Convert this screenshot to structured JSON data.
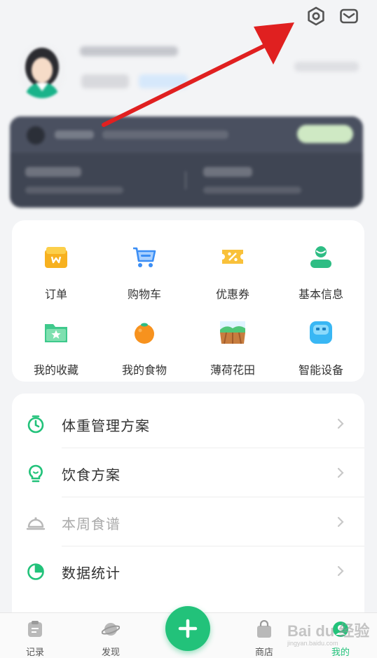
{
  "header": {
    "settings_icon": "gear-icon",
    "messages_icon": "mail-icon"
  },
  "quick_menu": [
    {
      "label": "订单",
      "icon": "order-box-icon"
    },
    {
      "label": "购物车",
      "icon": "shopping-cart-icon"
    },
    {
      "label": "优惠券",
      "icon": "coupon-icon"
    },
    {
      "label": "基本信息",
      "icon": "user-info-icon"
    },
    {
      "label": "我的收藏",
      "icon": "favorites-folder-icon"
    },
    {
      "label": "我的食物",
      "icon": "orange-fruit-icon"
    },
    {
      "label": "薄荷花田",
      "icon": "farm-field-icon"
    },
    {
      "label": "智能设备",
      "icon": "smart-device-icon"
    }
  ],
  "list_items": [
    {
      "label": "体重管理方案",
      "icon": "timer-icon"
    },
    {
      "label": "饮食方案",
      "icon": "lightbulb-icon"
    },
    {
      "label": "本周食谱",
      "icon": "food-cloche-icon"
    },
    {
      "label": "数据统计",
      "icon": "pie-chart-icon"
    }
  ],
  "tabs": [
    {
      "label": "记录",
      "icon": "record-icon"
    },
    {
      "label": "发现",
      "icon": "planet-icon"
    },
    {
      "label": "商店",
      "icon": "shop-bag-icon"
    },
    {
      "label": "我的",
      "icon": "me-icon"
    }
  ],
  "fab_icon": "plus-icon",
  "watermark": {
    "text": "Bai du 经验",
    "sub": "jingyan.baidu.com"
  },
  "colors": {
    "accent": "#22c27a",
    "arrow": "#e02020",
    "member_card": "#3f4553"
  }
}
